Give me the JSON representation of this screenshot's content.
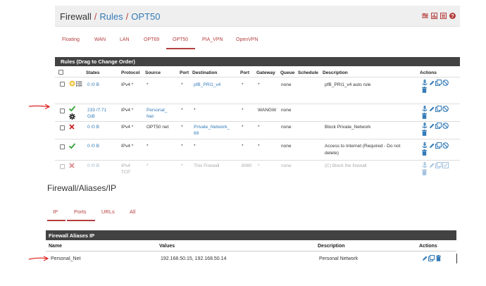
{
  "rules_page": {
    "breadcrumb": [
      "Firewall",
      "Rules",
      "OPT50"
    ],
    "tabs": [
      "Floating",
      "WAN",
      "LAN",
      "OPT69",
      "OPT50",
      "PIA_VPN",
      "OpenVPN"
    ],
    "active_tab": "OPT50",
    "panel_title": "Rules (Drag to Change Order)",
    "columns": [
      "States",
      "Protocol",
      "Source",
      "Port",
      "Destination",
      "Port",
      "Gateway",
      "Queue",
      "Schedule",
      "Description",
      "Actions"
    ],
    "rows": [
      {
        "states": "0 /0 B",
        "protocol": "IPv4 *",
        "source": "*",
        "port": "*",
        "destination": "pfB_PRI1_v4",
        "dport": "*",
        "gateway": "*",
        "queue": "none",
        "schedule": "",
        "description": "pfB_PRI1_v4 auto rule",
        "status": "hand"
      },
      {
        "states": "233 /7.71",
        "states2": "GiB",
        "protocol": "IPv4 *",
        "source": "Personal_",
        "source2": "Net",
        "port": "*",
        "destination": "*",
        "dport": "*",
        "gateway": "WANGW",
        "queue": "none",
        "schedule": "",
        "description": "",
        "status": "pass"
      },
      {
        "states": "0 /0 B",
        "protocol": "IPv4 *",
        "source": "OPT50 net",
        "port": "*",
        "destination": "Private_Network_",
        "destination2": "69",
        "dport": "*",
        "gateway": "*",
        "queue": "none",
        "schedule": "",
        "description": "Block Private_Network",
        "status": "block"
      },
      {
        "states": "0 /0 B",
        "protocol": "IPv4 *",
        "source": "*",
        "port": "*",
        "destination": "*",
        "dport": "*",
        "gateway": "*",
        "queue": "none",
        "schedule": "",
        "description": "Access to Internet (Required - Do not",
        "description2": "delete)",
        "status": "pass"
      },
      {
        "states": "0 /0 B",
        "protocol": "IPv4",
        "protocol2": "TCP",
        "source": "*",
        "port": "*",
        "destination": "This Firewall",
        "dport": "8080",
        "gateway": "*",
        "queue": "none",
        "schedule": "",
        "description": "(C) Block the firewall",
        "status": "block-disabled"
      }
    ]
  },
  "aliases_page": {
    "breadcrumb": [
      "Firewall",
      "Aliases",
      "IP"
    ],
    "tabs": [
      "IP",
      "Ports",
      "URLs",
      "All"
    ],
    "active_tab": "IP",
    "panel_title": "Firewall Aliases IP",
    "columns": [
      "Name",
      "Values",
      "Description",
      "Actions"
    ],
    "rows": [
      {
        "name": "Personal_Net",
        "values": "192.168.50.15, 192.168.50.14",
        "description": "Personal Network"
      }
    ]
  },
  "colors": {
    "accent": "#b53f3f",
    "link": "#337ab7",
    "panel_header": "#424242",
    "pass": "#2e9e2e",
    "block": "#cc2222",
    "annotation_arrow": "#e02020"
  },
  "icons": [
    "settings-sliders-icon",
    "bar-chart-icon",
    "list-icon",
    "help-icon",
    "anchor-icon",
    "pencil-icon",
    "copy-icon",
    "disable-icon",
    "trash-icon",
    "checkmark-icon",
    "cross-icon",
    "gear-icon",
    "hand-icon"
  ]
}
